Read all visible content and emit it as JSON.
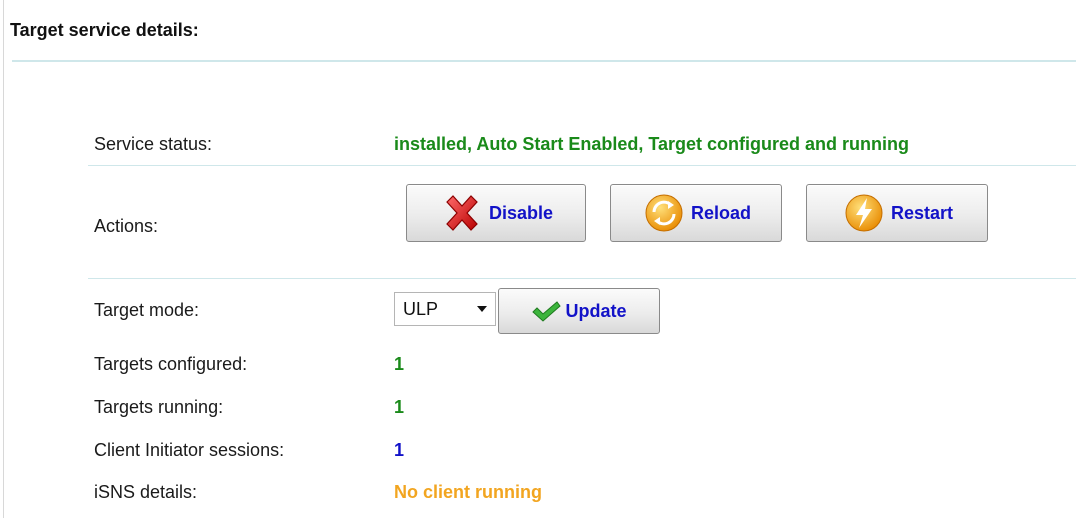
{
  "section": {
    "title": "Target service details:"
  },
  "rows": {
    "service_status": {
      "label": "Service status:",
      "value": "installed, Auto Start Enabled, Target configured and running",
      "value_color": "#1a8a1a"
    },
    "actions": {
      "label": "Actions:",
      "buttons": [
        {
          "label": "Disable",
          "icon": "red-x-icon"
        },
        {
          "label": "Reload",
          "icon": "reload-icon"
        },
        {
          "label": "Restart",
          "icon": "lightning-icon"
        }
      ]
    },
    "target_mode": {
      "label": "Target mode:",
      "selected": "ULP",
      "update_label": "Update",
      "update_icon": "green-check-icon"
    },
    "targets_configured": {
      "label": "Targets configured:",
      "value": "1",
      "value_color": "#1a8a1a"
    },
    "targets_running": {
      "label": "Targets running:",
      "value": "1",
      "value_color": "#1a8a1a"
    },
    "client_sessions": {
      "label": "Client Initiator sessions:",
      "value": "1",
      "value_color": "#1212c8"
    },
    "isns": {
      "label": "iSNS details:",
      "value": "No client running",
      "value_color": "#f2a520"
    }
  },
  "colors": {
    "rule": "#cfe7ea",
    "button_text": "#1212c8"
  }
}
